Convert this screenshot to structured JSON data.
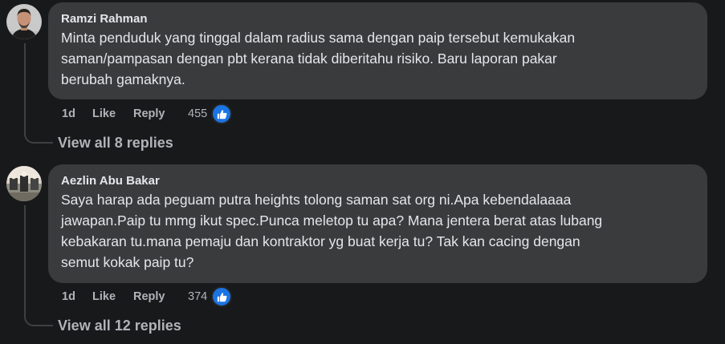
{
  "comments": [
    {
      "author": "Ramzi Rahman",
      "text": "Minta penduduk yang tinggal dalam radius sama dengan paip tersebut kemukakan\nsaman/pampasan dengan pbt kerana tidak diberitahu risiko. Baru laporan pakar\nberubah gamaknya.",
      "time": "1d",
      "like_label": "Like",
      "reply_label": "Reply",
      "reaction_count": "455",
      "reaction_icon": "like-thumbs-up-icon",
      "view_replies": "View all 8 replies"
    },
    {
      "author": "Aezlin Abu Bakar",
      "text": "Saya harap ada peguam putra heights tolong saman sat org ni.Apa kebendalaaaa\njawapan.Paip tu mmg ikut spec.Punca meletop tu apa? Mana jentera berat atas lubang\nkebakaran tu.mana pemaju dan kontraktor yg buat kerja tu? Tak kan cacing dengan\nsemut kokak paip tu?",
      "time": "1d",
      "like_label": "Like",
      "reply_label": "Reply",
      "reaction_count": "374",
      "reaction_icon": "like-thumbs-up-icon",
      "view_replies": "View all 12 replies"
    }
  ],
  "colors": {
    "background": "#18191a",
    "bubble": "#3a3b3c",
    "primary_text": "#e4e6eb",
    "secondary_text": "#b0b3b8",
    "like_blue": "#1b74e4"
  }
}
